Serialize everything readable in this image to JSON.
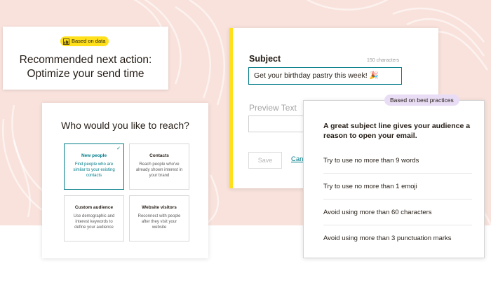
{
  "recommendation": {
    "badge_label": "Based on data",
    "badge_icon": "chart-icon",
    "title_line1": "Recommended next action:",
    "title_line2": "Optimize your send time"
  },
  "audience": {
    "title": "Who would you like to reach?",
    "options": [
      {
        "title": "New people",
        "description": "Find people who are similar to your existing contacts",
        "selected": true
      },
      {
        "title": "Contacts",
        "description": "Reach people who've already shown interest in your brand",
        "selected": false
      },
      {
        "title": "Custom audience",
        "description": "Use demographic and interest keywords to define your audience",
        "selected": false
      },
      {
        "title": "Website visitors",
        "description": "Reconnect with people after they visit your website",
        "selected": false
      }
    ]
  },
  "subject_editor": {
    "label": "Subject",
    "char_count": "150 characters",
    "value": "Get your birthday pastry this week! 🎉",
    "preview_label": "Preview Text",
    "save_label": "Save",
    "cancel_label": "Cancel"
  },
  "best_practices": {
    "badge_label": "Based on best practices",
    "heading": "A great subject line gives your audience a reason to open your email.",
    "tips": [
      "Try to use no more than 9 words",
      "Try to use no more than 1 emoji",
      "Avoid using more than 60 characters",
      "Avoid using more than 3 punctuation marks"
    ]
  },
  "colors": {
    "background": "#f9e2dc",
    "accent_yellow": "#ffe01b",
    "teal": "#007c89",
    "lavender": "#e9ddf5"
  }
}
